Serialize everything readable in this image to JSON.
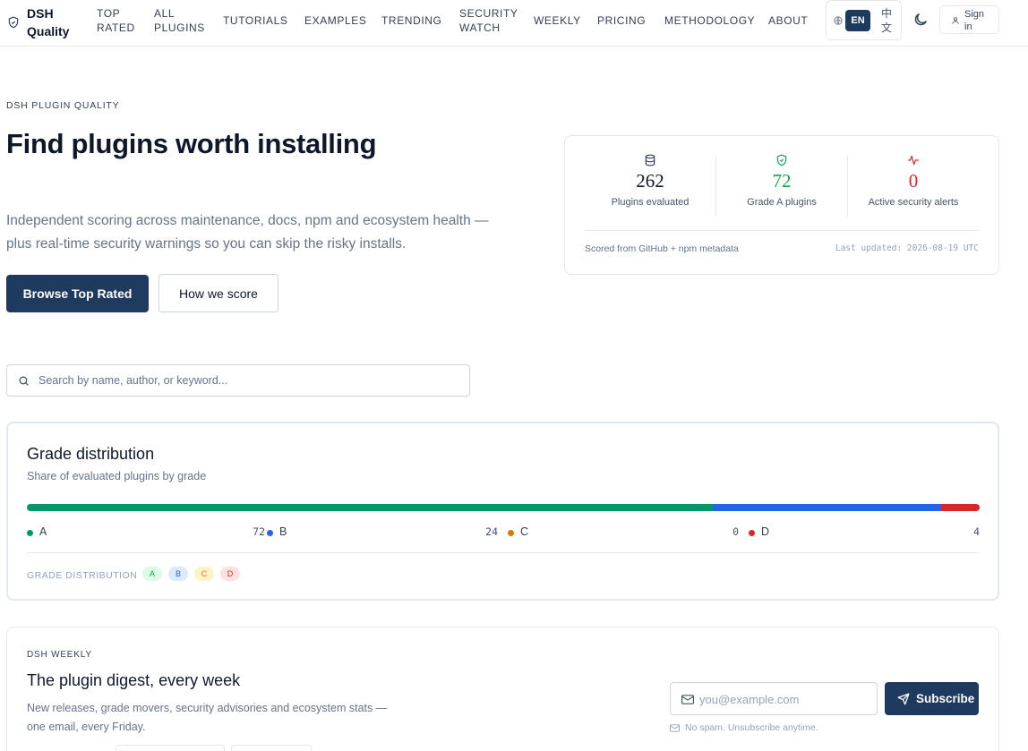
{
  "brand": {
    "name": "DSH Quality"
  },
  "nav": {
    "links": [
      "TOP RATED",
      "ALL PLUGINS",
      "TUTORIALS",
      "EXAMPLES",
      "TRENDING",
      "SECURITY WATCH",
      "WEEKLY",
      "PRICING",
      "METHODOLOGY",
      "ABOUT"
    ],
    "lang_en": "EN",
    "lang_zh": "中文",
    "sign_in": "Sign in"
  },
  "hero": {
    "eyebrow": "DSH PLUGIN QUALITY",
    "title": "Find plugins worth installing",
    "subtitle": "Independent scoring across maintenance, docs, npm and ecosystem health — plus real-time security warnings so you can skip the risky installs.",
    "primary_button": "Browse Top Rated",
    "secondary_button": "How we score"
  },
  "stats": {
    "items": [
      {
        "value": "262",
        "label": "Plugins evaluated",
        "icon": "database-icon",
        "color": "#0f172a"
      },
      {
        "value": "72",
        "label": "Grade A plugins",
        "icon": "shield-check-icon",
        "color": "#16a34a"
      },
      {
        "value": "0",
        "label": "Active security alerts",
        "icon": "activity-icon",
        "color": "#dc2626"
      }
    ],
    "source": "Scored from GitHub + npm metadata",
    "updated": "Last updated: 2026-08-19 UTC"
  },
  "search": {
    "placeholder": "Search by name, author, or keyword..."
  },
  "grade_distribution": {
    "title": "Grade distribution",
    "subtitle": "Share of evaluated plugins by grade",
    "footer_label": "GRADE DISTRIBUTION",
    "grades": [
      {
        "grade": "A",
        "count": 72,
        "color": "#059669",
        "chip_bg": "#dcfce7",
        "chip_fg": "#16a34a"
      },
      {
        "grade": "B",
        "count": 24,
        "color": "#2563eb",
        "chip_bg": "#dbeafe",
        "chip_fg": "#2563eb"
      },
      {
        "grade": "C",
        "count": 0,
        "color": "#d97706",
        "chip_bg": "#fef3c7",
        "chip_fg": "#d97706"
      },
      {
        "grade": "D",
        "count": 4,
        "color": "#dc2626",
        "chip_bg": "#fee2e2",
        "chip_fg": "#dc2626"
      }
    ]
  },
  "weekly": {
    "eyebrow": "DSH WEEKLY",
    "title": "The plugin digest, every week",
    "description": "New releases, grade movers, security advisories and ecosystem stats — one email, every Friday.",
    "email_placeholder": "you@example.com",
    "subscribe_button": "Subscribe",
    "note": "No spam. Unsubscribe anytime."
  },
  "colors": {
    "primary": "#1e3a5f",
    "border": "#e5e7eb",
    "muted": "#64748b"
  }
}
